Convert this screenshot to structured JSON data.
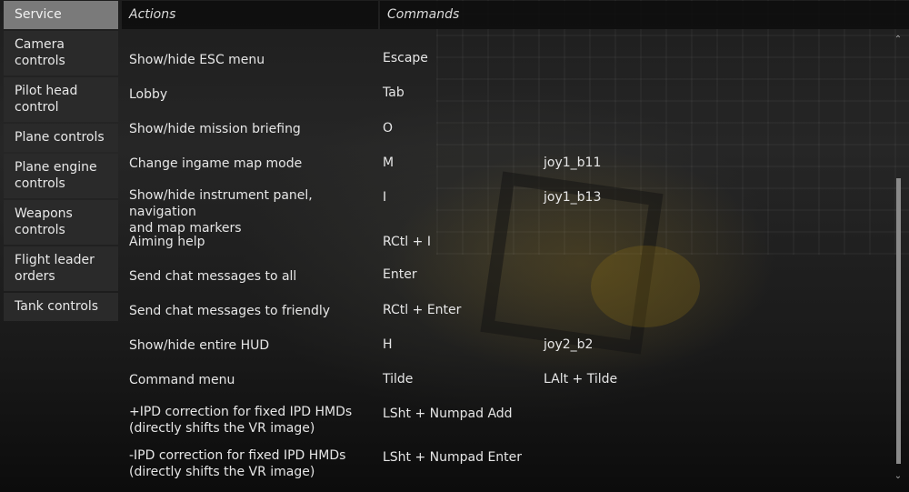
{
  "sidebar": {
    "items": [
      {
        "label": "Service",
        "line2": ""
      },
      {
        "label": "Camera controls",
        "line2": ""
      },
      {
        "label": "Pilot head",
        "line2": "control"
      },
      {
        "label": "Plane controls",
        "line2": ""
      },
      {
        "label": "Plane engine",
        "line2": "controls"
      },
      {
        "label": "Weapons",
        "line2": "controls"
      },
      {
        "label": "Flight leader",
        "line2": "orders"
      },
      {
        "label": "Tank controls",
        "line2": ""
      }
    ]
  },
  "header": {
    "actions": "Actions",
    "commands": "Commands"
  },
  "rows": [
    {
      "action": "Show/hide ESC menu",
      "action2": "",
      "cmd1": "Escape",
      "cmd2": ""
    },
    {
      "action": "Lobby",
      "action2": "",
      "cmd1": "Tab",
      "cmd2": ""
    },
    {
      "action": "Show/hide mission briefing",
      "action2": "",
      "cmd1": "O",
      "cmd2": ""
    },
    {
      "action": "Change ingame map mode",
      "action2": "",
      "cmd1": "M",
      "cmd2": "joy1_b11"
    },
    {
      "action": "Show/hide instrument panel, navigation",
      "action2": "and map markers",
      "cmd1": "I",
      "cmd2": "joy1_b13"
    },
    {
      "action": "Aiming help",
      "action2": "",
      "cmd1": "RCtl + I",
      "cmd2": ""
    },
    {
      "action": "Send chat messages to all",
      "action2": "",
      "cmd1": "Enter",
      "cmd2": ""
    },
    {
      "action": "Send chat messages to friendly",
      "action2": "",
      "cmd1": "RCtl + Enter",
      "cmd2": ""
    },
    {
      "action": "Show/hide entire HUD",
      "action2": "",
      "cmd1": "H",
      "cmd2": "joy2_b2"
    },
    {
      "action": "Command menu",
      "action2": "",
      "cmd1": "Tilde",
      "cmd2": "LAlt + Tilde"
    },
    {
      "action": "+IPD correction for fixed IPD HMDs",
      "action2": "(directly shifts the VR image)",
      "cmd1": "LSht + Numpad Add",
      "cmd2": ""
    },
    {
      "action": "-IPD correction for fixed IPD HMDs",
      "action2": "(directly shifts the VR image)",
      "cmd1": "LSht + Numpad Enter",
      "cmd2": ""
    }
  ]
}
